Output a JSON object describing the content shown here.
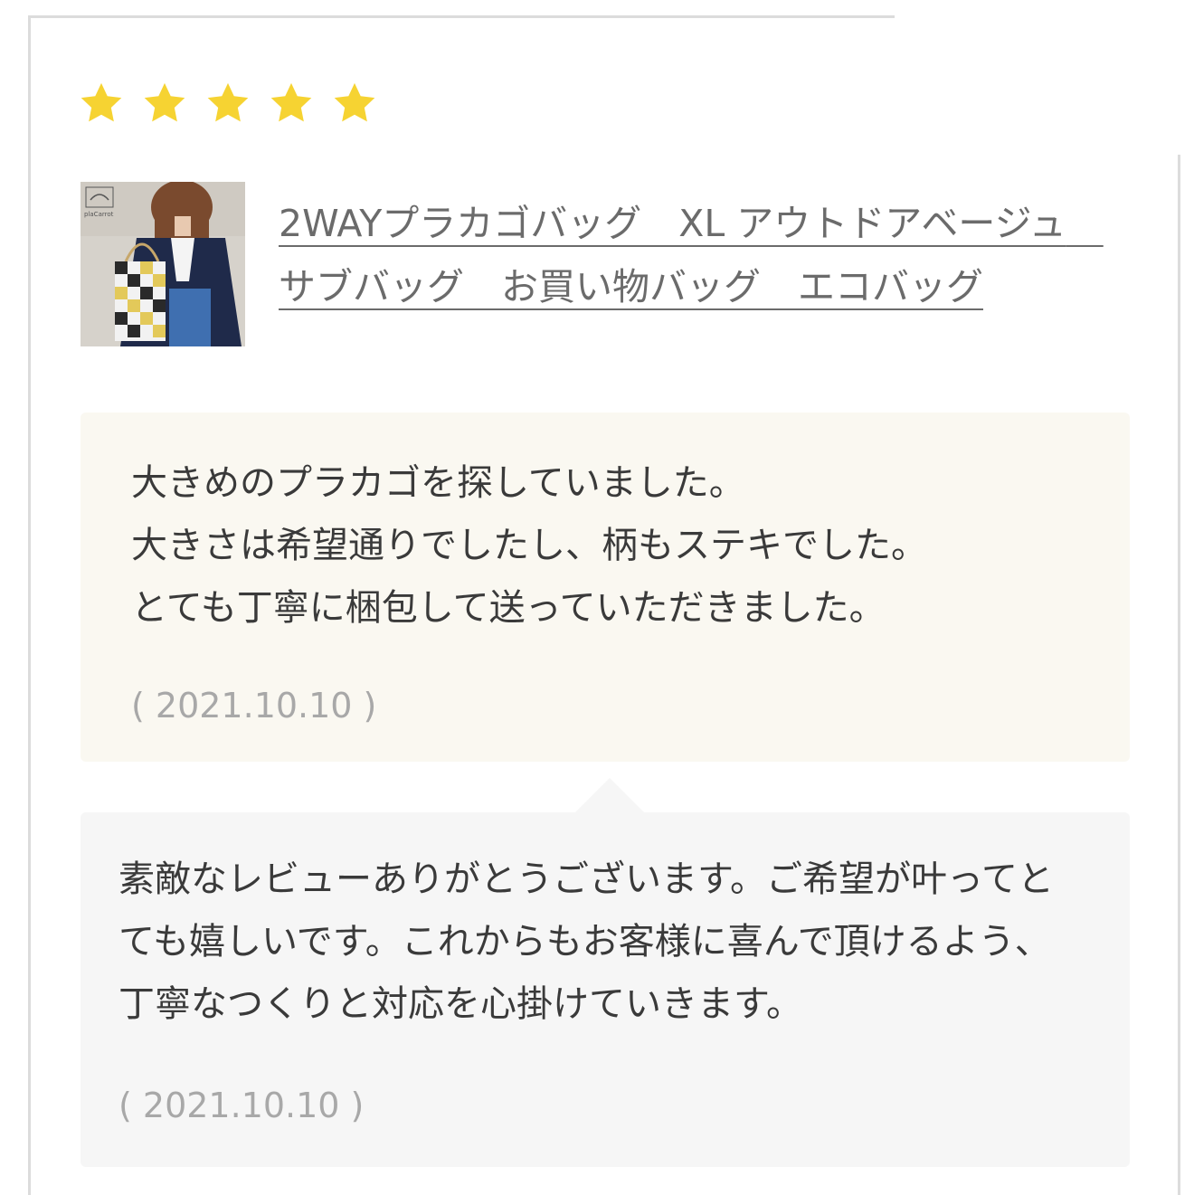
{
  "review": {
    "rating": 5,
    "rating_max": 5,
    "star_color": "#f6d332",
    "product": {
      "title": "2WAYプラカゴバッグ　XL アウトドアベージュ　サブバッグ　お買い物バッグ　エコバッグ",
      "thumbnail_logo_text": "plaCarrot"
    },
    "body_lines": [
      "大きめのプラカゴを探していました。",
      "大きさは希望通りでしたし、柄もステキでした。",
      "とても丁寧に梱包して送っていただきました。"
    ],
    "date": "( 2021.10.10 )"
  },
  "reply": {
    "text": "素敵なレビューありがとうございます。ご希望が叶ってとても嬉しいです。これからもお客様に喜んで頂けるよう、丁寧なつくりと対応を心掛けていきます。",
    "date": "( 2021.10.10 )"
  },
  "colors": {
    "review_bg": "#faf8f1",
    "reply_bg": "#f6f6f6",
    "link": "#6b6b6b",
    "date": "#a8a8a8"
  }
}
